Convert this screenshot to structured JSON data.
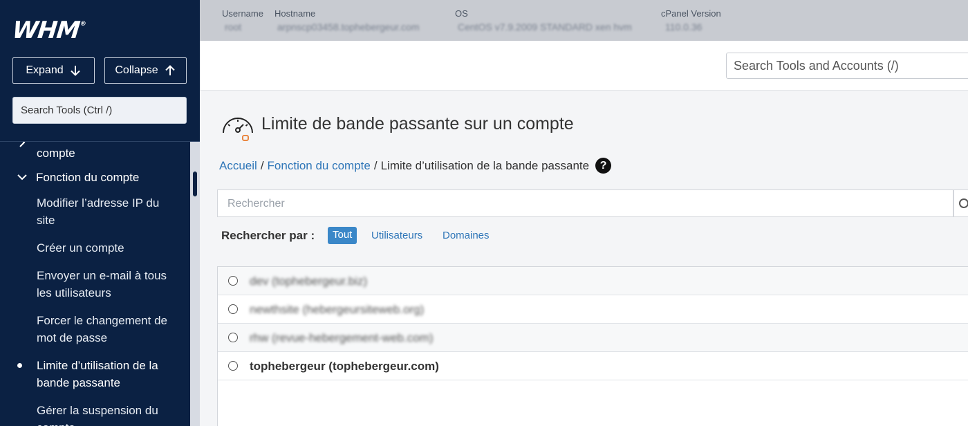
{
  "sidebar": {
    "logo": "WHM",
    "expand_label": "Expand",
    "collapse_label": "Collapse",
    "search_placeholder": "Search Tools (Ctrl /)",
    "items": [
      {
        "label": "compte",
        "type": "partial"
      },
      {
        "label": "Fonction du compte",
        "type": "section"
      },
      {
        "label": "Modifier l’adresse IP du site",
        "type": "link"
      },
      {
        "label": "Créer un compte",
        "type": "link"
      },
      {
        "label": "Envoyer un e-mail à tous les utilisateurs",
        "type": "link"
      },
      {
        "label": "Forcer le changement de mot de passe",
        "type": "link"
      },
      {
        "label": "Limite d’utilisation de la bande passante",
        "type": "active"
      },
      {
        "label": "Gérer la suspension du compte",
        "type": "link"
      }
    ]
  },
  "infobar": {
    "username_label": "Username",
    "username_value": "root",
    "hostname_label": "Hostname",
    "hostname_value": "arpnscp03458.tophebergeur.com",
    "os_label": "OS",
    "os_value": "CentOS v7.9.2009 STANDARD xen hvm",
    "cpanel_label": "cPanel Version",
    "cpanel_value": "110.0.36"
  },
  "header": {
    "search_placeholder": "Search Tools and Accounts (/)"
  },
  "page": {
    "title": "Limite de bande passante sur un compte",
    "breadcrumb": [
      "Accueil",
      "Fonction du compte",
      "Limite d’utilisation de la bande passante"
    ],
    "help": "?"
  },
  "filter": {
    "search_placeholder": "Rechercher",
    "by_label": "Rechercher par :",
    "options": [
      "Tout",
      "Utilisateurs",
      "Domaines"
    ]
  },
  "accounts": [
    {
      "label": "dev (tophebergeur.biz)",
      "blurred": true
    },
    {
      "label": "newthsite (hebergeursiteweb.org)",
      "blurred": true
    },
    {
      "label": "rhw (revue-hebergement-web.com)",
      "blurred": true
    },
    {
      "label": "tophebergeur (tophebergeur.com)",
      "blurred": false
    }
  ],
  "colors": {
    "sidebar_bg": "#0b2143",
    "accent": "#3a87c8",
    "link": "#2f76b8",
    "icon_accent": "#e8782a"
  }
}
